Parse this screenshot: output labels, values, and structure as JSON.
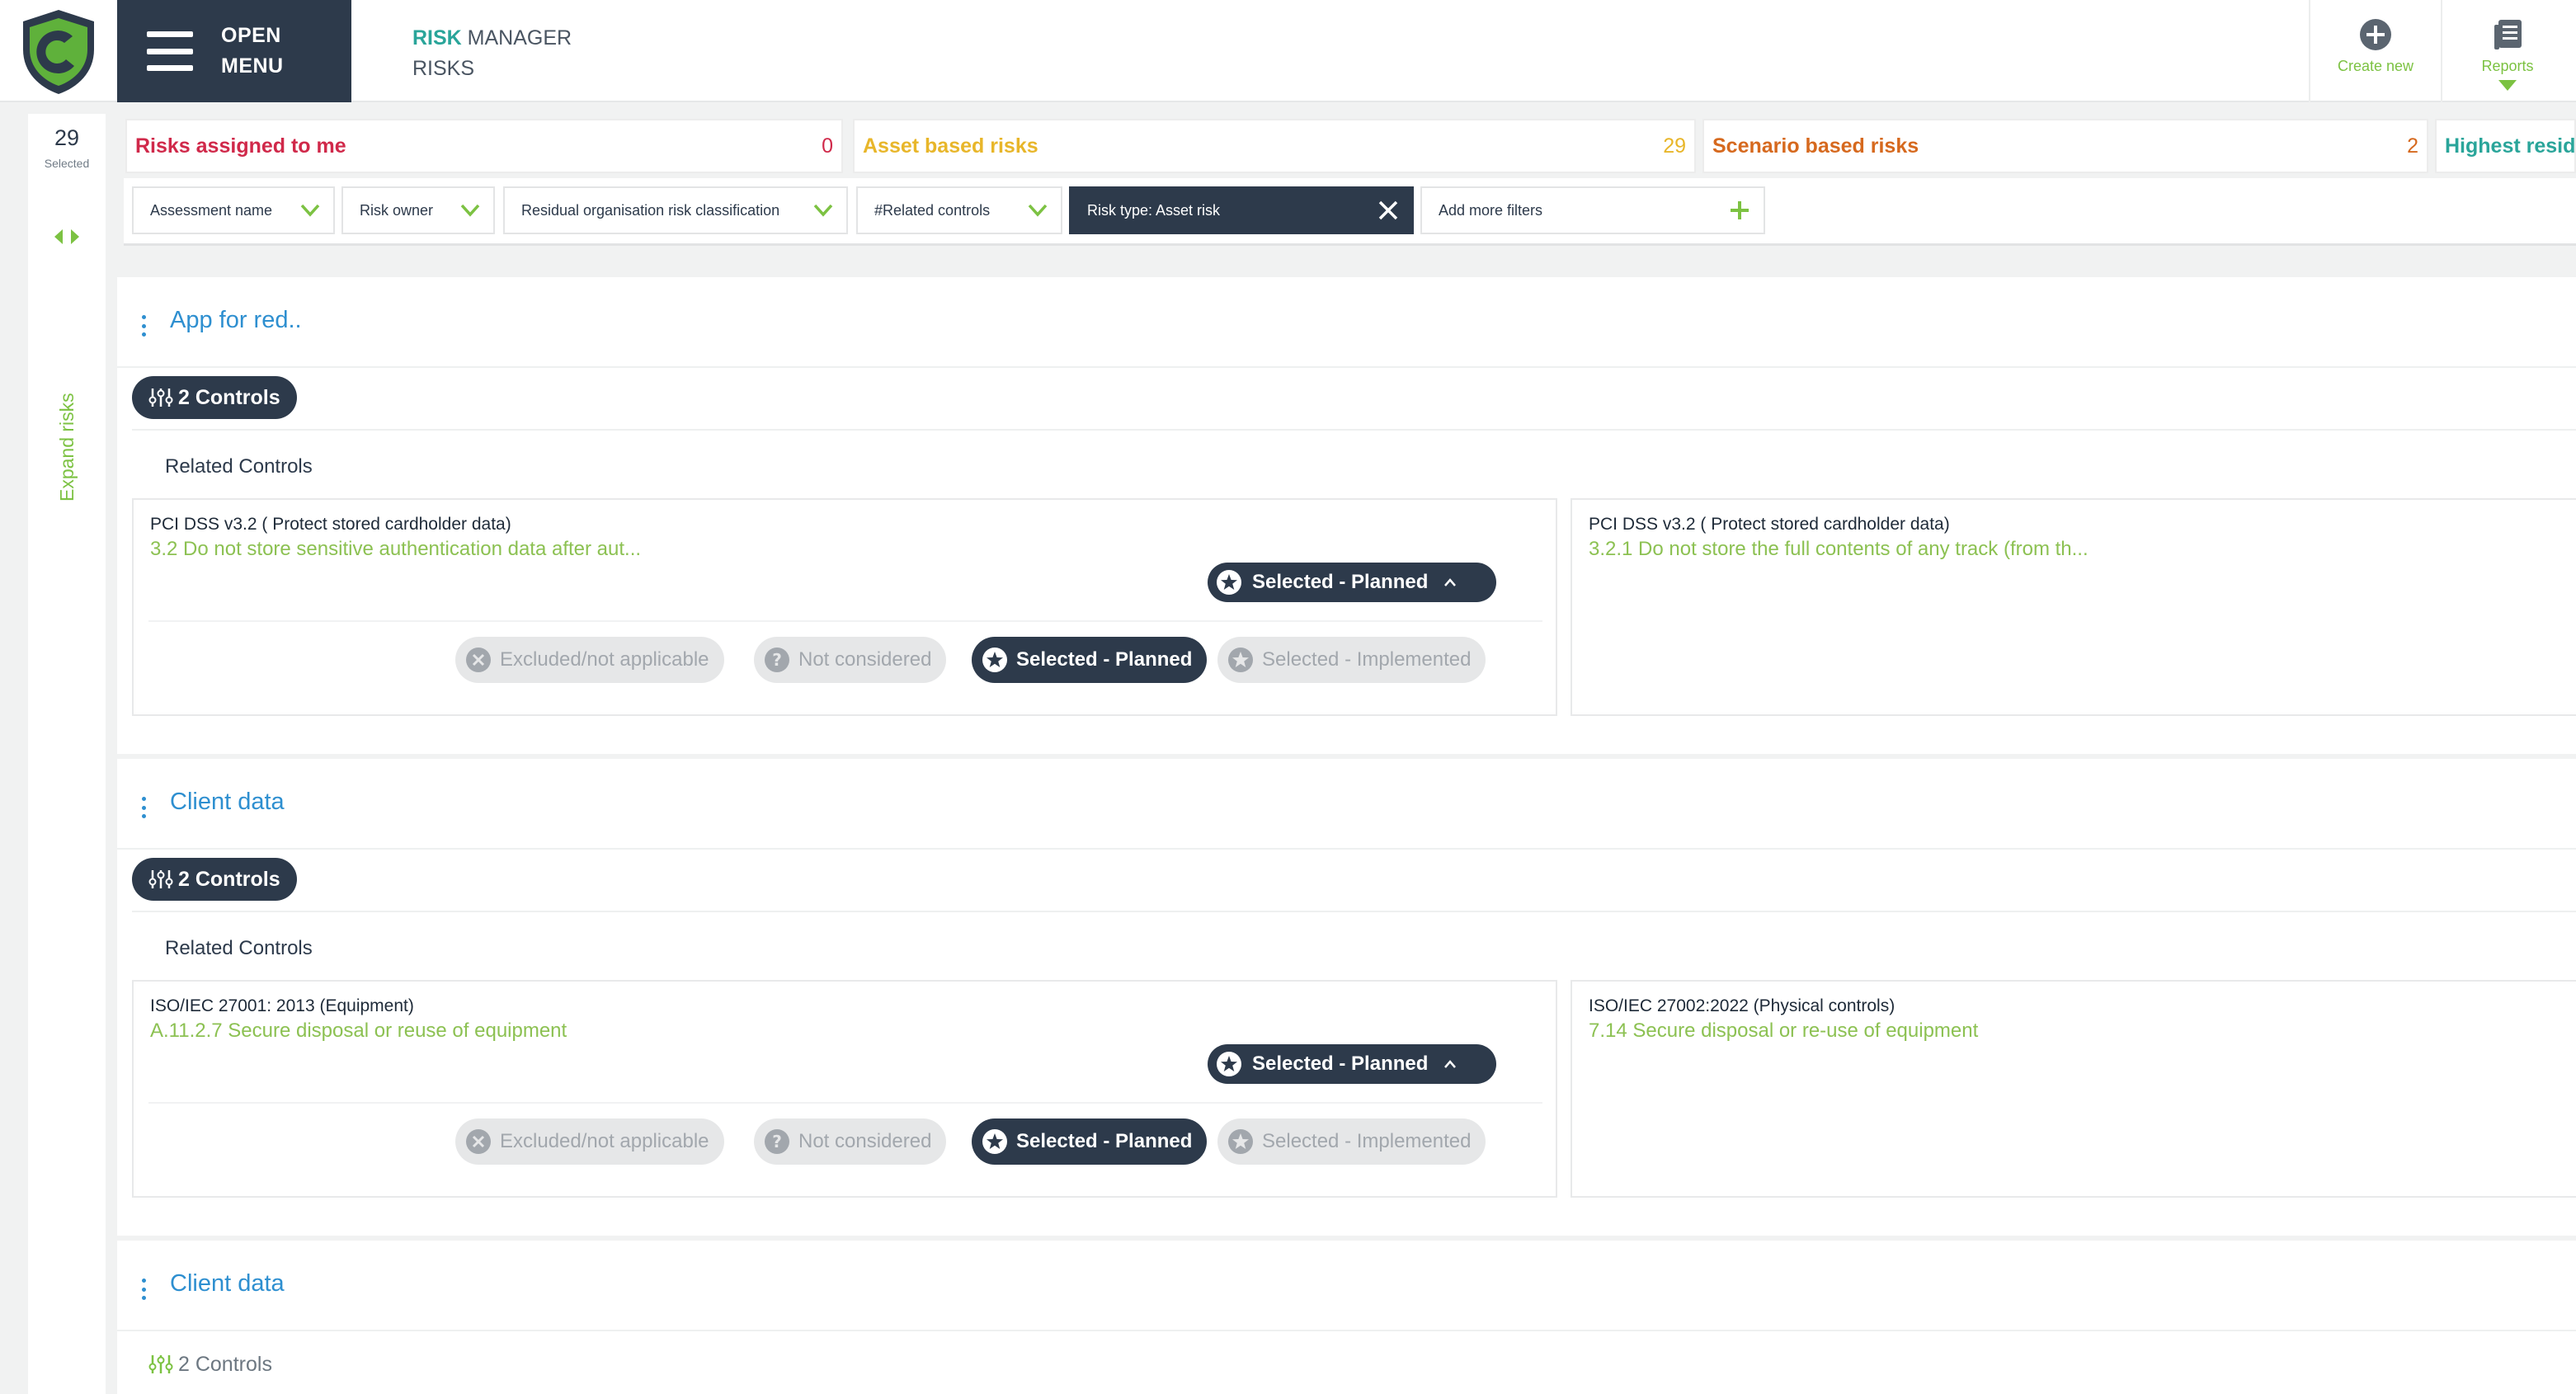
{
  "header": {
    "menu_line1": "OPEN",
    "menu_line2": "MENU",
    "app_accent": "RISK",
    "app_rest": " MANAGER",
    "page": "RISKS",
    "create_label": "Create new",
    "reports_label": "Reports"
  },
  "rail": {
    "count": "29",
    "count_label": "Selected",
    "expand_label": "Expand risks"
  },
  "summary": [
    {
      "label": "Risks assigned to me",
      "count": "0",
      "color": "#d0294a"
    },
    {
      "label": "Asset based risks",
      "count": "29",
      "color": "#e8b62a"
    },
    {
      "label": "Scenario based risks",
      "count": "2",
      "color": "#d6691e"
    },
    {
      "label": "Highest residual risks",
      "count": "",
      "color": "#2aa59a"
    }
  ],
  "filters": [
    {
      "label": "Assessment name"
    },
    {
      "label": "Risk owner"
    },
    {
      "label": "Residual organisation risk classification"
    },
    {
      "label": "#Related controls"
    },
    {
      "label": "Risk type: Asset risk"
    },
    {
      "label": "Add more filters"
    }
  ],
  "groups": [
    {
      "title": "App for red..",
      "controls_label": "2 Controls",
      "related_label": "Related Controls",
      "left": {
        "name": "PCI DSS v3.2 ( Protect stored cardholder data)",
        "desc": "3.2 Do not store sensitive authentication data after aut...",
        "status": "Selected - Planned"
      },
      "right": {
        "name": "PCI DSS v3.2 ( Protect stored cardholder data)",
        "desc": "3.2.1 Do not store the full contents of any track (from th..."
      },
      "options": [
        "Excluded/not applicable",
        "Not considered",
        "Selected - Planned",
        "Selected - Implemented"
      ]
    },
    {
      "title": "Client data",
      "controls_label": "2 Controls",
      "related_label": "Related Controls",
      "left": {
        "name": "ISO/IEC 27001: 2013 (Equipment)",
        "desc": "A.11.2.7 Secure disposal or reuse of equipment",
        "status": "Selected - Planned"
      },
      "right": {
        "name": "ISO/IEC 27002:2022 (Physical controls)",
        "desc": "7.14 Secure disposal or re-use of equipment"
      },
      "options": [
        "Excluded/not applicable",
        "Not considered",
        "Selected - Planned",
        "Selected - Implemented"
      ]
    },
    {
      "title": "Client data",
      "controls_label": "2 Controls"
    }
  ],
  "colors": {
    "navy": "#2d3a4b",
    "green": "#7cc242",
    "link_blue": "#2e8fd0",
    "teal": "#2aa59a"
  }
}
